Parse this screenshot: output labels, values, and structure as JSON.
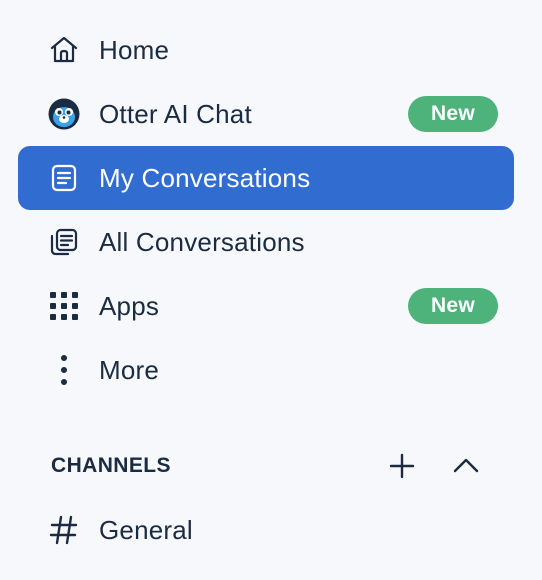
{
  "nav": {
    "items": [
      {
        "label": "Home",
        "icon": "home-icon"
      },
      {
        "label": "Otter AI Chat",
        "icon": "otter-avatar-icon",
        "badge": "New"
      },
      {
        "label": "My Conversations",
        "icon": "document-icon",
        "active": true
      },
      {
        "label": "All Conversations",
        "icon": "documents-stack-icon"
      },
      {
        "label": "Apps",
        "icon": "grid-icon",
        "badge": "New"
      },
      {
        "label": "More",
        "icon": "vertical-dots-icon"
      }
    ]
  },
  "channels": {
    "title": "CHANNELS",
    "add_icon": "plus-icon",
    "collapse_icon": "chevron-up-icon",
    "items": [
      {
        "label": "General",
        "icon": "hash-icon"
      }
    ]
  },
  "colors": {
    "background": "#f6f8fc",
    "active": "#316dd0",
    "badge": "#4db37a",
    "text": "#1b2b41"
  }
}
